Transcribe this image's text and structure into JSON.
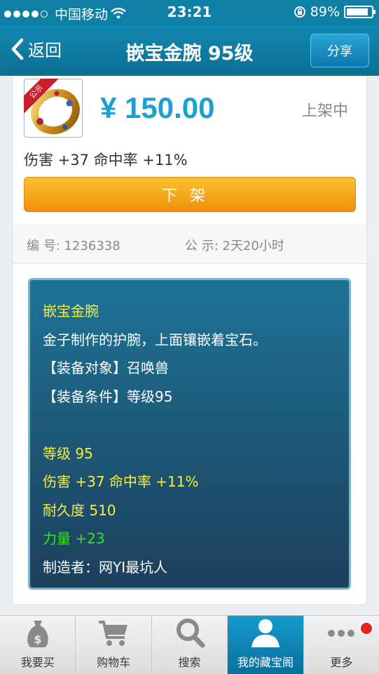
{
  "status_bar": {
    "carrier": "中国移动",
    "time": "23:21",
    "battery": "89%",
    "battery_level": 0.89
  },
  "nav": {
    "back_label": "返回",
    "title": "嵌宝金腕 95级",
    "share_label": "分享"
  },
  "item": {
    "ribbon": "公示",
    "price": "¥ 150.00",
    "status": "上架中",
    "stats": "伤害 +37 命中率 +11%",
    "delist_label": "下架",
    "id_label": "编  号:",
    "id_value": "1236338",
    "public_label": "公  示:",
    "public_value": "2天20小时"
  },
  "detail": {
    "lines": [
      {
        "text": "嵌宝金腕",
        "color": "#f6ef3c"
      },
      {
        "text": "金子制作的护腕，上面镶嵌着宝石。",
        "color": "#ffffff"
      },
      {
        "text": "【装备对象】召唤兽",
        "color": "#ffffff"
      },
      {
        "text": "【装备条件】等级95",
        "color": "#ffffff"
      },
      {
        "text": "",
        "color": "#ffffff"
      },
      {
        "text": "等级 95",
        "color": "#f6ef3c"
      },
      {
        "text": "伤害 +37 命中率 +11%",
        "color": "#f6ef3c"
      },
      {
        "text": "耐久度 510",
        "color": "#f6ef3c"
      },
      {
        "text": "力量 +23",
        "color": "#34e51b"
      },
      {
        "text": "制造者：网YI最坑人",
        "color": "#ffffff"
      }
    ]
  },
  "tabs": [
    {
      "label": "我要买",
      "icon": "money-bag-icon"
    },
    {
      "label": "购物车",
      "icon": "cart-icon"
    },
    {
      "label": "搜索",
      "icon": "search-icon"
    },
    {
      "label": "我的藏宝阁",
      "icon": "user-icon"
    },
    {
      "label": "更多",
      "icon": "more-icon"
    }
  ],
  "colors": {
    "accent": "#1aa0d2",
    "nav": "#0f7fa5",
    "button": "#f5a11e",
    "ribbon": "#c8202a"
  }
}
